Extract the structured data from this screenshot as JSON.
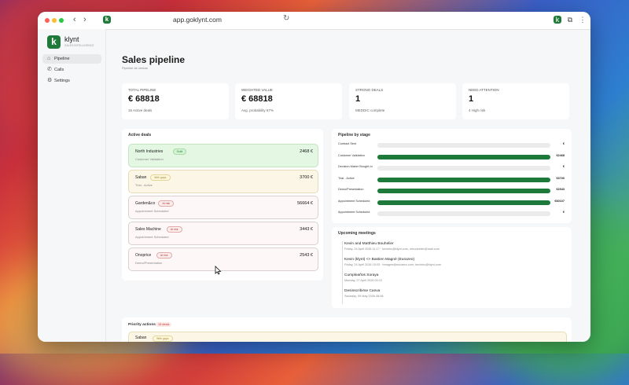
{
  "browser": {
    "url": "app.goklynt.com"
  },
  "brand": {
    "logo_letter": "k",
    "name": "klynt",
    "tagline": "SALES INTELLIGENCE"
  },
  "nav": [
    {
      "label": "Pipeline",
      "icon": "home-icon",
      "active": true
    },
    {
      "label": "Calls",
      "icon": "phone-icon",
      "active": false
    },
    {
      "label": "Settings",
      "icon": "gear-icon",
      "active": false
    }
  ],
  "page": {
    "title": "Sales pipeline",
    "subtitle": "Pipeline de ventas"
  },
  "kpis": [
    {
      "label": "TOTAL PIPELINE",
      "value": "€ 68818",
      "sub": "16 Active deals"
    },
    {
      "label": "WEIGHTED VALUE",
      "value": "€ 68818",
      "sub": "Avg. probability 67%"
    },
    {
      "label": "STRONG DEALS",
      "value": "1",
      "sub": "MEDDIC complete"
    },
    {
      "label": "NEED ATTENTION",
      "value": "1",
      "sub": "4 High risk"
    }
  ],
  "active_deals": {
    "title": "Active deals",
    "items": [
      {
        "name": "North Industries",
        "tag": "Solid",
        "stage": "Customer Validation",
        "amount": "2468 €",
        "status": "solid"
      },
      {
        "name": "Saban",
        "tag": "With gaps",
        "stage": "Trial - Active",
        "amount": "3700 €",
        "status": "gaps"
      },
      {
        "name": "Garden&co",
        "tag": "At risk",
        "stage": "Appointment Scheduled",
        "amount": "56664 €",
        "status": "risk"
      },
      {
        "name": "Sales Machine",
        "tag": "At risk",
        "stage": "Appointment Scheduled",
        "amount": "3443 €",
        "status": "risk"
      },
      {
        "name": "Onoprice",
        "tag": "At risk",
        "stage": "Demo/Presentation",
        "amount": "2543 €",
        "status": "risk"
      }
    ]
  },
  "pipeline_by_stage": {
    "title": "Pipeline by stage",
    "stages": [
      {
        "label": "Contract Sent",
        "value": "€",
        "fill": 0
      },
      {
        "label": "Customer Validation",
        "value": "€2468",
        "fill": 1
      },
      {
        "label": "Decision Maker Bought-In",
        "value": "€",
        "fill": 0
      },
      {
        "label": "Trial - Active",
        "value": "€3700",
        "fill": 1
      },
      {
        "label": "Demo/Presentation",
        "value": "€2543",
        "fill": 1
      },
      {
        "label": "Appointment Scheduled",
        "value": "€60107",
        "fill": 1
      },
      {
        "label": "Appointment Scheduled",
        "value": "€",
        "fill": 0
      }
    ]
  },
  "upcoming_meetings": {
    "title": "Upcoming meetings",
    "items": [
      {
        "title": "Kevin and Matthieu Bouhelier",
        "time": "Friday, 24 April 2026 11:17 · kevinhc@klynt.com, mbouhelier@mail.com"
      },
      {
        "title": "Kevin (klynt) <> Bastien Magné (Eurazeo)",
        "time": "Friday, 24 April 2026 15:03 · bmagne@eurazeo.com, kevinhc@klynt.com"
      },
      {
        "title": "Cumpleaños Soraya",
        "time": "Monday, 27 April 2026 00:12"
      },
      {
        "title": "Desinscribirse Canva",
        "time": "Saturday, 09 May 2026 08:08"
      }
    ]
  },
  "priority_actions": {
    "title": "Priority actions",
    "badge": "15 deals",
    "first_item": "Saban",
    "first_tag": "With gaps"
  },
  "colors": {
    "brand": "#1f7a3a",
    "solid_bg": "#e3f7e3",
    "gaps_bg": "#fbf6e6",
    "risk_bg": "#fdf7f7"
  }
}
